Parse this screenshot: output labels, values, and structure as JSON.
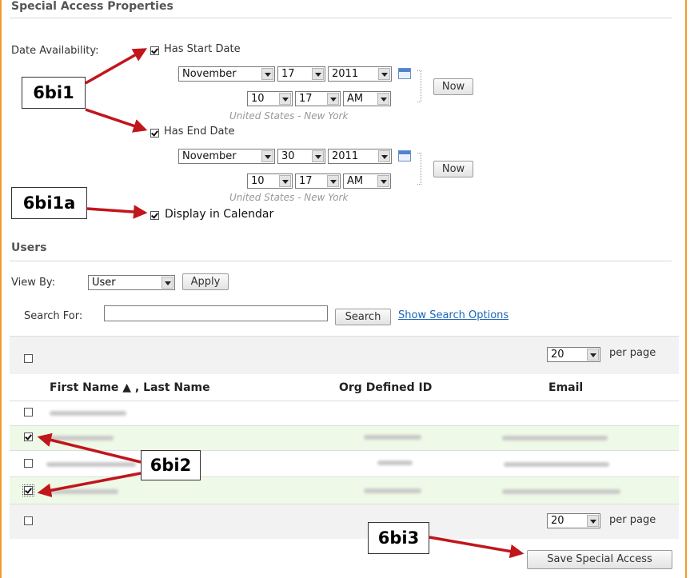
{
  "special_access": {
    "title": "Special Access Properties",
    "date_availability_label": "Date Availability:",
    "has_start_date_label": "Has Start Date",
    "has_end_date_label": "Has End Date",
    "display_in_calendar_label": "Display in Calendar",
    "start": {
      "month": "November",
      "day": "17",
      "year": "2011",
      "hour": "10",
      "minute": "17",
      "ampm": "AM",
      "timezone": "United States - New York",
      "now_label": "Now"
    },
    "end": {
      "month": "November",
      "day": "30",
      "year": "2011",
      "hour": "10",
      "minute": "17",
      "ampm": "AM",
      "timezone": "United States - New York",
      "now_label": "Now"
    }
  },
  "users": {
    "title": "Users",
    "view_by_label": "View By:",
    "view_by_value": "User",
    "apply_label": "Apply",
    "search_for_label": "Search For:",
    "search_value": "",
    "search_button": "Search",
    "show_search_options": "Show Search Options",
    "per_page_value": "20",
    "per_page_label": "per page",
    "columns": [
      "First Name ▲ , Last Name",
      "Org Defined ID",
      "Email"
    ],
    "save_button": "Save Special Access"
  },
  "callouts": {
    "c1": "6bi1",
    "c1a": "6bi1a",
    "c2": "6bi2",
    "c3": "6bi3"
  },
  "colors": {
    "accent_border": "#f29b2a",
    "selected_row": "#eef9e7",
    "arrow": "#c0161c",
    "link": "#1a66b8"
  }
}
